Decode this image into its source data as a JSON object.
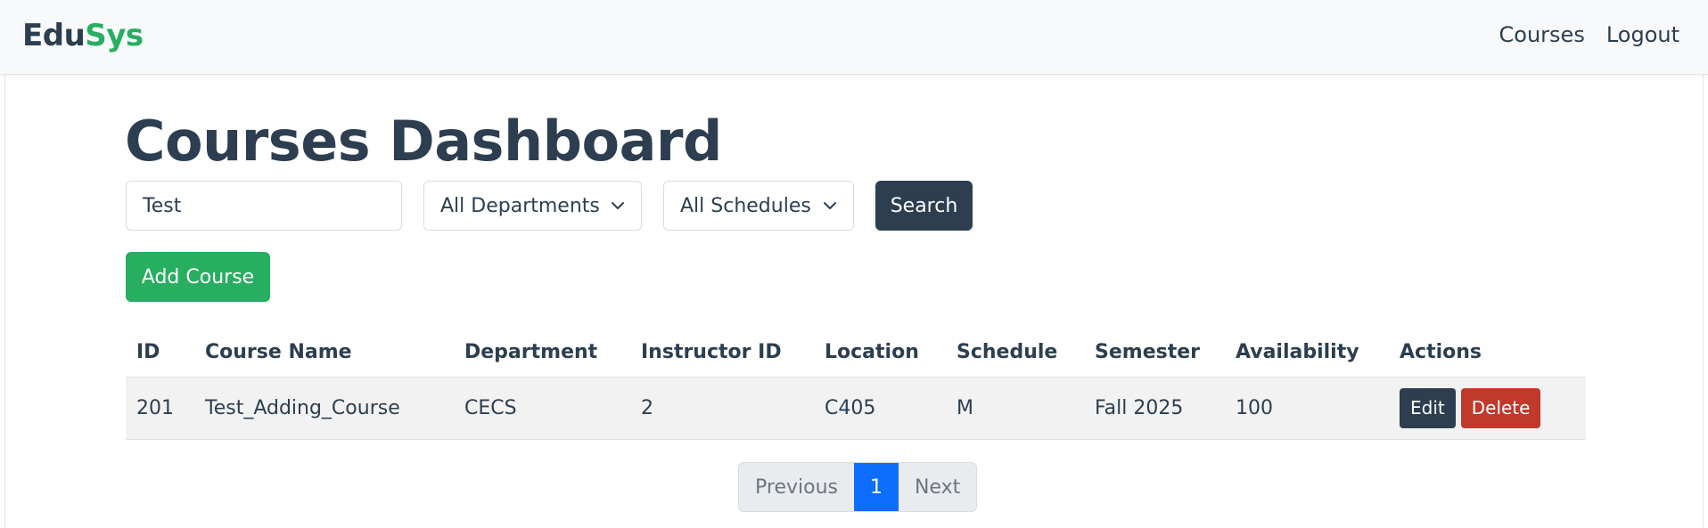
{
  "brand": {
    "part1": "Edu",
    "part2": "Sys"
  },
  "nav": {
    "courses": "Courses",
    "logout": "Logout"
  },
  "page_title": "Courses Dashboard",
  "filters": {
    "search_value": "Test",
    "department_selected": "All Departments",
    "schedule_selected": "All Schedules",
    "search_button": "Search"
  },
  "add_course_button": "Add Course",
  "table": {
    "headers": [
      "ID",
      "Course Name",
      "Department",
      "Instructor ID",
      "Location",
      "Schedule",
      "Semester",
      "Availability",
      "Actions"
    ],
    "rows": [
      {
        "id": "201",
        "course_name": "Test_Adding_Course",
        "department": "CECS",
        "instructor_id": "2",
        "location": "C405",
        "schedule": "M",
        "semester": "Fall 2025",
        "availability": "100",
        "edit": "Edit",
        "delete": "Delete"
      }
    ]
  },
  "pagination": {
    "previous": "Previous",
    "current": "1",
    "next": "Next"
  },
  "colors": {
    "primary_dark": "#2c3e50",
    "success": "#27ae60",
    "danger": "#c0392b",
    "active_page": "#0d6efd"
  },
  "icons": {
    "select_chevron": "chevron-down-icon"
  }
}
